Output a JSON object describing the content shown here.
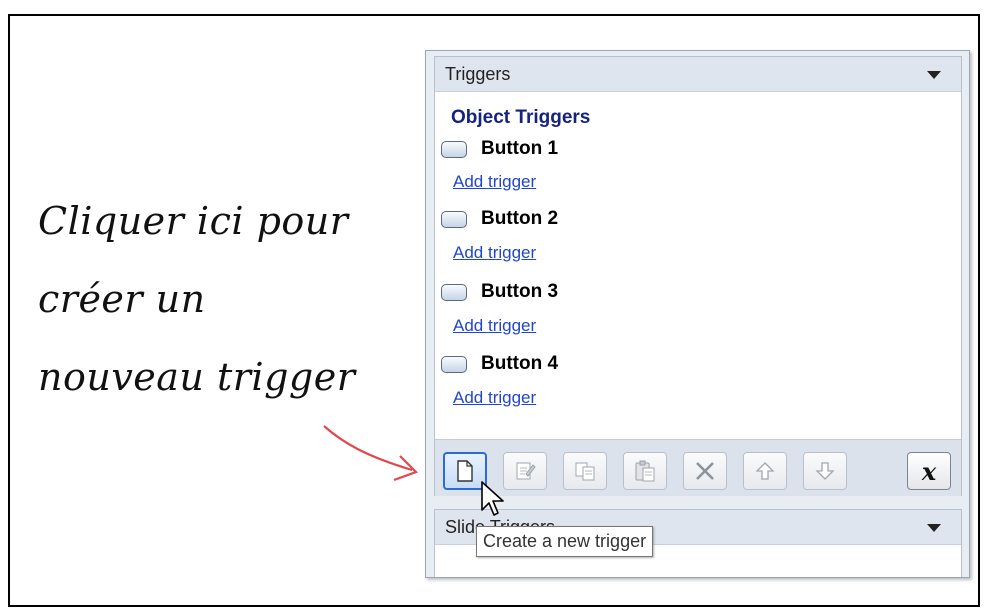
{
  "callout": {
    "lines": [
      "Cliquer ici pour",
      "créer un",
      "nouveau trigger"
    ]
  },
  "triggers_pane": {
    "title": "Triggers",
    "section_title": "Object Triggers",
    "objects": [
      {
        "label": "Button 1",
        "link": "Add trigger"
      },
      {
        "label": "Button 2",
        "link": "Add trigger"
      },
      {
        "label": "Button 3",
        "link": "Add trigger"
      },
      {
        "label": "Button 4",
        "link": "Add trigger"
      }
    ],
    "toolbar": [
      {
        "name": "new-trigger-button",
        "icon": "new-document-icon"
      },
      {
        "name": "edit-trigger-button",
        "icon": "edit-icon"
      },
      {
        "name": "copy-trigger-button",
        "icon": "copy-icon"
      },
      {
        "name": "paste-trigger-button",
        "icon": "paste-icon"
      },
      {
        "name": "delete-trigger-button",
        "icon": "delete-icon"
      },
      {
        "name": "move-up-button",
        "icon": "arrow-up-icon"
      },
      {
        "name": "move-down-button",
        "icon": "arrow-down-icon"
      },
      {
        "name": "variables-button",
        "icon": "variable-x-icon",
        "label": "x"
      }
    ]
  },
  "slide_pane": {
    "title": "Slide Triggers"
  },
  "tooltip": {
    "text": "Create a new trigger"
  },
  "colors": {
    "link": "#2146c9",
    "section_title": "#15237f",
    "annotation_arrow": "#e2474f",
    "active_border": "#2b6bd6"
  }
}
